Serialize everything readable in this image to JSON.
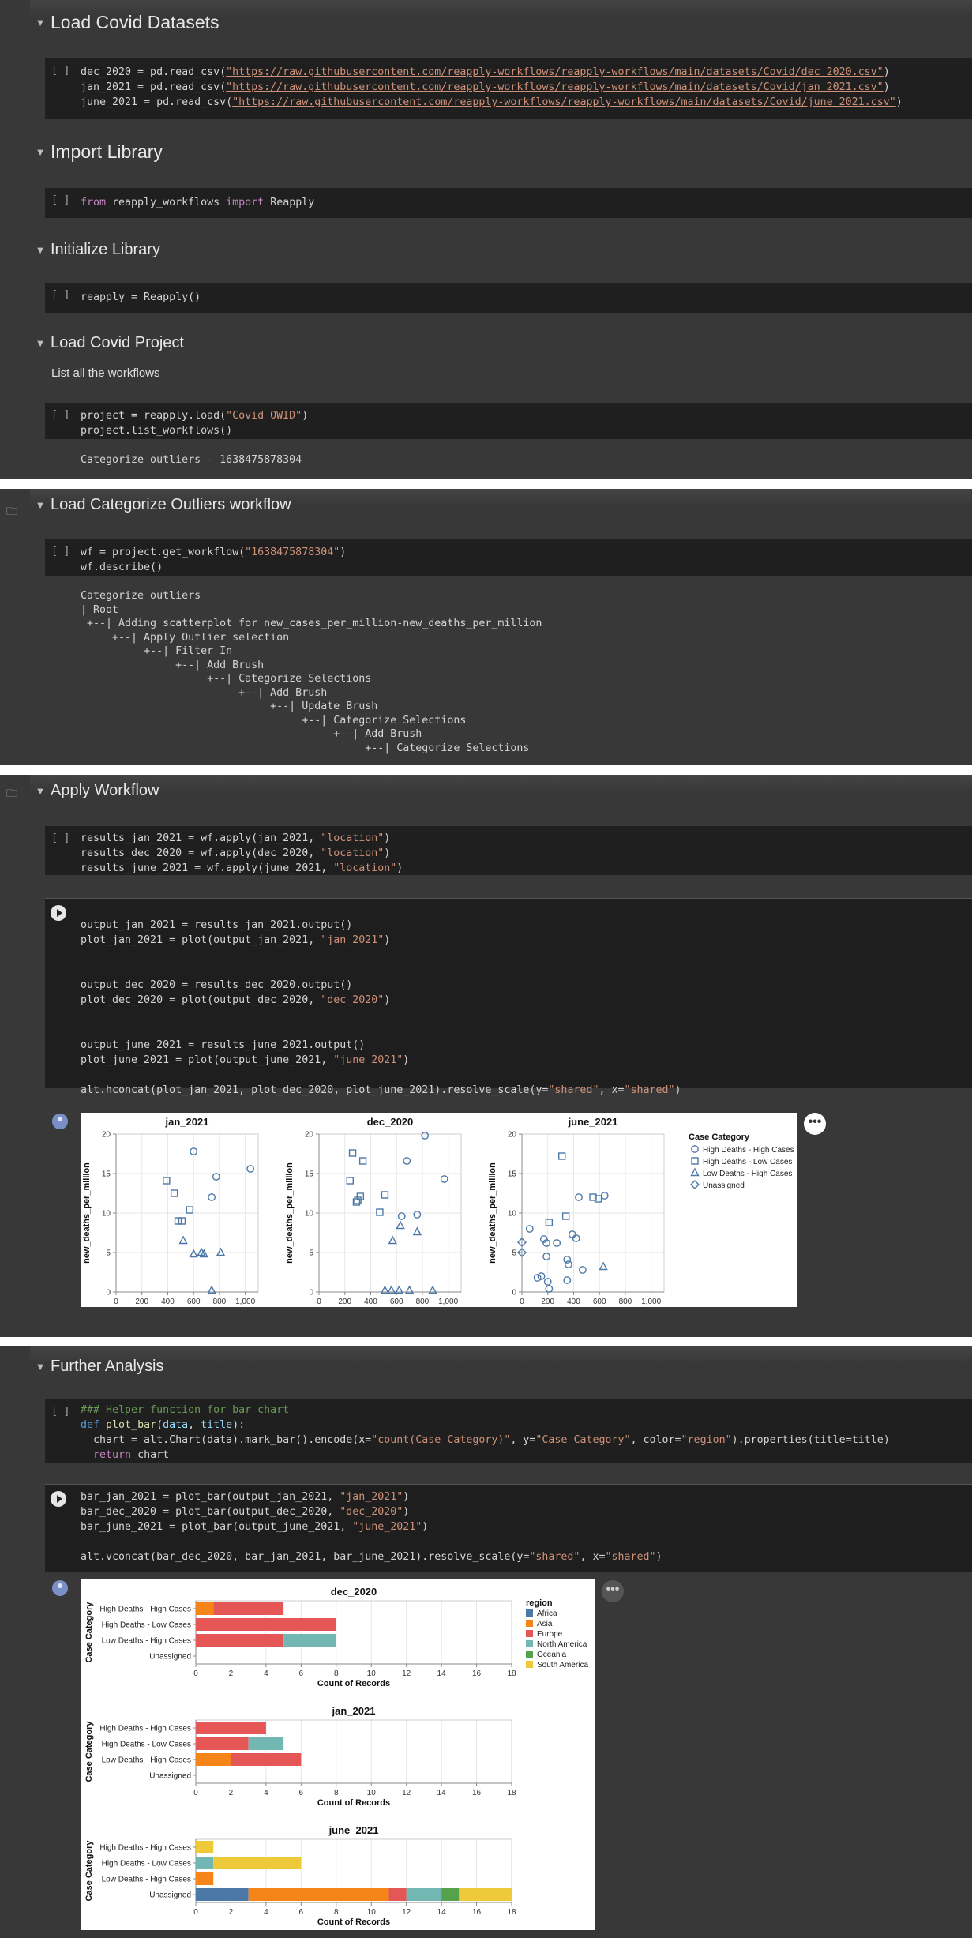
{
  "sections": {
    "load_datasets": {
      "title": "Load Covid Datasets"
    },
    "import_library": {
      "title": "Import Library"
    },
    "initialize_library": {
      "title": "Initialize Library"
    },
    "load_project": {
      "title": "Load Covid Project",
      "description": "List all the workflows"
    },
    "load_workflow": {
      "title": "Load Categorize Outliers workflow"
    },
    "apply_workflow": {
      "title": "Apply Workflow"
    },
    "further_analysis": {
      "title": "Further Analysis"
    }
  },
  "cells": {
    "datasets": {
      "bracket": "[ ]",
      "lines": [
        "dec_2020 = pd.read_csv(\"https://raw.githubusercontent.com/reapply-workflows/reapply-workflows/main/datasets/Covid/dec_2020.csv\")",
        "jan_2021 = pd.read_csv(\"https://raw.githubusercontent.com/reapply-workflows/reapply-workflows/main/datasets/Covid/jan_2021.csv\")",
        "june_2021 = pd.read_csv(\"https://raw.githubusercontent.com/reapply-workflows/reapply-workflows/main/datasets/Covid/june_2021.csv\")"
      ]
    },
    "import": {
      "bracket": "[ ]",
      "line": "from reapply_workflows import Reapply"
    },
    "init": {
      "bracket": "[ ]",
      "line": "reapply = Reapply()"
    },
    "project": {
      "bracket": "[ ]",
      "lines": [
        "project = reapply.load(\"Covid OWID\")",
        "project.list_workflows()"
      ],
      "output": "Categorize outliers - 1638475878304"
    },
    "workflow": {
      "bracket": "[ ]",
      "lines": [
        "wf = project.get_workflow(\"1638475878304\")",
        "wf.describe()"
      ],
      "output": [
        "Categorize outliers",
        "| Root",
        " +--| Adding scatterplot for new_cases_per_million-new_deaths_per_million",
        "     +--| Apply Outlier selection",
        "          +--| Filter In",
        "               +--| Add Brush",
        "                    +--| Categorize Selections",
        "                         +--| Add Brush",
        "                              +--| Update Brush",
        "                                   +--| Categorize Selections",
        "                                        +--| Add Brush",
        "                                             +--| Categorize Selections"
      ]
    },
    "apply": {
      "bracket": "[ ]",
      "lines": [
        "results_jan_2021 = wf.apply(jan_2021, \"location\")",
        "results_dec_2020 = wf.apply(dec_2020, \"location\")",
        "results_june_2021 = wf.apply(june_2021, \"location\")"
      ]
    },
    "plot": {
      "lines": [
        "output_jan_2021 = results_jan_2021.output()",
        "plot_jan_2021 = plot(output_jan_2021, \"jan_2021\")",
        "output_dec_2020 = results_dec_2020.output()",
        "plot_dec_2020 = plot(output_dec_2020, \"dec_2020\")",
        "output_june_2021 = results_june_2021.output()",
        "plot_june_2021 = plot(output_june_2021, \"june_2021\")",
        "alt.hconcat(plot_jan_2021, plot_dec_2020, plot_june_2021).resolve_scale(y=\"shared\", x=\"shared\")"
      ]
    },
    "helper": {
      "bracket": "[ ]",
      "lines": [
        "### Helper function for bar chart",
        "def plot_bar(data, title):",
        "  chart = alt.Chart(data).mark_bar().encode(x=\"count(Case Category)\", y=\"Case Category\", color=\"region\").properties(title=title)",
        "  return chart"
      ]
    },
    "bars": {
      "lines": [
        "bar_jan_2021 = plot_bar(output_jan_2021, \"jan_2021\")",
        "bar_dec_2020 = plot_bar(output_dec_2020, \"dec_2020\")",
        "bar_june_2021 = plot_bar(output_june_2021, \"june_2021\")",
        "alt.vconcat(bar_dec_2020, bar_jan_2021, bar_june_2021).resolve_scale(y=\"shared\", x=\"shared\")"
      ]
    }
  },
  "more_label": "•••",
  "colors": {
    "accent": "#4c78a8"
  },
  "chart_data": [
    {
      "type": "scatter",
      "title": "jan_2021",
      "xlabel": "new_cases_per_million",
      "ylabel": "new_deaths_per_million",
      "xlim": [
        0,
        1100
      ],
      "ylim": [
        0,
        20
      ],
      "xticks": [
        0,
        200,
        400,
        600,
        800,
        1000
      ],
      "xtick_labels": [
        "0",
        "200",
        "400",
        "600",
        "800",
        "1,000"
      ],
      "yticks": [
        0,
        5,
        10,
        15,
        20
      ],
      "series": [
        {
          "name": "High Deaths - High Cases",
          "points": [
            [
              600,
              17.8
            ],
            [
              775,
              14.6
            ],
            [
              1040,
              15.6
            ],
            [
              740,
              12.0
            ]
          ]
        },
        {
          "name": "High Deaths - Low Cases",
          "points": [
            [
              390,
              14.1
            ],
            [
              450,
              12.5
            ],
            [
              480,
              9.0
            ],
            [
              510,
              9.0
            ],
            [
              570,
              10.4
            ]
          ]
        },
        {
          "name": "Low Deaths - High Cases",
          "points": [
            [
              520,
              6.5
            ],
            [
              600,
              4.8
            ],
            [
              660,
              5.0
            ],
            [
              680,
              4.8
            ],
            [
              810,
              5.0
            ],
            [
              740,
              0.2
            ]
          ]
        },
        {
          "name": "Unassigned",
          "points": []
        }
      ]
    },
    {
      "type": "scatter",
      "title": "dec_2020",
      "xlabel": "new_cases_per_million",
      "ylabel": "new_deaths_per_million",
      "xlim": [
        0,
        1100
      ],
      "ylim": [
        0,
        20
      ],
      "xticks": [
        0,
        200,
        400,
        600,
        800,
        1000
      ],
      "xtick_labels": [
        "0",
        "200",
        "400",
        "600",
        "800",
        "1,000"
      ],
      "yticks": [
        0,
        5,
        10,
        15,
        20
      ],
      "series": [
        {
          "name": "High Deaths - High Cases",
          "points": [
            [
              820,
              19.8
            ],
            [
              680,
              16.6
            ],
            [
              970,
              14.3
            ],
            [
              760,
              9.8
            ],
            [
              640,
              9.6
            ]
          ]
        },
        {
          "name": "High Deaths - Low Cases",
          "points": [
            [
              260,
              17.6
            ],
            [
              340,
              16.6
            ],
            [
              240,
              14.1
            ],
            [
              300,
              11.6
            ],
            [
              320,
              12.1
            ],
            [
              290,
              11.4
            ],
            [
              510,
              12.3
            ],
            [
              470,
              10.1
            ]
          ]
        },
        {
          "name": "Low Deaths - High Cases",
          "points": [
            [
              570,
              6.5
            ],
            [
              630,
              8.4
            ],
            [
              760,
              7.6
            ],
            [
              510,
              0.2
            ],
            [
              560,
              0.2
            ],
            [
              620,
              0.2
            ],
            [
              700,
              0.2
            ],
            [
              880,
              0.2
            ]
          ]
        },
        {
          "name": "Unassigned",
          "points": []
        }
      ]
    },
    {
      "type": "scatter",
      "title": "june_2021",
      "xlabel": "new_cases_per_million",
      "ylabel": "new_deaths_per_million",
      "xlim": [
        0,
        1100
      ],
      "ylim": [
        0,
        20
      ],
      "xticks": [
        0,
        200,
        400,
        600,
        800,
        1000
      ],
      "xtick_labels": [
        "0",
        "200",
        "400",
        "600",
        "800",
        "1,000"
      ],
      "yticks": [
        0,
        5,
        10,
        15,
        20
      ],
      "series": [
        {
          "name": "High Deaths - High Cases",
          "points": [
            [
              60,
              8.0
            ],
            [
              170,
              6.7
            ],
            [
              190,
              6.2
            ],
            [
              270,
              6.2
            ],
            [
              350,
              4.1
            ],
            [
              360,
              3.5
            ],
            [
              390,
              7.3
            ],
            [
              420,
              6.8
            ],
            [
              440,
              12.0
            ],
            [
              470,
              2.8
            ],
            [
              640,
              12.2
            ],
            [
              350,
              1.5
            ],
            [
              190,
              4.5
            ],
            [
              150,
              2.0
            ],
            [
              120,
              1.8
            ],
            [
              200,
              1.3
            ],
            [
              210,
              0.4
            ]
          ]
        },
        {
          "name": "High Deaths - Low Cases",
          "points": [
            [
              310,
              17.2
            ],
            [
              210,
              8.8
            ],
            [
              340,
              9.6
            ],
            [
              550,
              12.0
            ],
            [
              590,
              11.8
            ]
          ]
        },
        {
          "name": "Low Deaths - High Cases",
          "points": [
            [
              630,
              3.2
            ]
          ]
        },
        {
          "name": "Unassigned",
          "points": [
            [
              0,
              6.3
            ],
            [
              0,
              5.0
            ]
          ]
        }
      ]
    },
    {
      "type": "bar",
      "title": "dec_2020",
      "xlabel": "Count of Records",
      "ylabel": "Case Category",
      "xlim": [
        0,
        18
      ],
      "xticks": [
        0,
        2,
        4,
        6,
        8,
        10,
        12,
        14,
        16,
        18
      ],
      "categories": [
        "High Deaths - High Cases",
        "High Deaths - Low Cases",
        "Low Deaths - High Cases",
        "Unassigned"
      ],
      "series": [
        {
          "name": "Africa",
          "values": [
            0,
            0,
            0,
            0
          ]
        },
        {
          "name": "Asia",
          "values": [
            1,
            0,
            0,
            0
          ]
        },
        {
          "name": "Europe",
          "values": [
            4,
            8,
            5,
            0
          ]
        },
        {
          "name": "North America",
          "values": [
            0,
            0,
            3,
            0
          ]
        },
        {
          "name": "Oceania",
          "values": [
            0,
            0,
            0,
            0
          ]
        },
        {
          "name": "South America",
          "values": [
            0,
            0,
            0,
            0
          ]
        }
      ]
    },
    {
      "type": "bar",
      "title": "jan_2021",
      "xlabel": "Count of Records",
      "ylabel": "Case Category",
      "xlim": [
        0,
        18
      ],
      "xticks": [
        0,
        2,
        4,
        6,
        8,
        10,
        12,
        14,
        16,
        18
      ],
      "categories": [
        "High Deaths - High Cases",
        "High Deaths - Low Cases",
        "Low Deaths - High Cases",
        "Unassigned"
      ],
      "series": [
        {
          "name": "Africa",
          "values": [
            0,
            0,
            0,
            0
          ]
        },
        {
          "name": "Asia",
          "values": [
            0,
            0,
            2,
            0
          ]
        },
        {
          "name": "Europe",
          "values": [
            4,
            3,
            4,
            0
          ]
        },
        {
          "name": "North America",
          "values": [
            0,
            2,
            0,
            0
          ]
        },
        {
          "name": "Oceania",
          "values": [
            0,
            0,
            0,
            0
          ]
        },
        {
          "name": "South America",
          "values": [
            0,
            0,
            0,
            0
          ]
        }
      ]
    },
    {
      "type": "bar",
      "title": "june_2021",
      "xlabel": "Count of Records",
      "ylabel": "Case Category",
      "xlim": [
        0,
        18
      ],
      "xticks": [
        0,
        2,
        4,
        6,
        8,
        10,
        12,
        14,
        16,
        18
      ],
      "categories": [
        "High Deaths - High Cases",
        "High Deaths - Low Cases",
        "Low Deaths - High Cases",
        "Unassigned"
      ],
      "series": [
        {
          "name": "Africa",
          "values": [
            0,
            0,
            0,
            3
          ]
        },
        {
          "name": "Asia",
          "values": [
            0,
            0,
            1,
            8
          ]
        },
        {
          "name": "Europe",
          "values": [
            0,
            0,
            0,
            1
          ]
        },
        {
          "name": "North America",
          "values": [
            0,
            1,
            0,
            2
          ]
        },
        {
          "name": "Oceania",
          "values": [
            0,
            0,
            0,
            1
          ]
        },
        {
          "name": "South America",
          "values": [
            1,
            5,
            0,
            3
          ]
        }
      ]
    }
  ],
  "scatter_legend": {
    "title": "Case Category",
    "items": [
      "High Deaths - High Cases",
      "High Deaths - Low Cases",
      "Low Deaths - High Cases",
      "Unassigned"
    ]
  },
  "bar_legend": {
    "title": "region",
    "items": [
      {
        "name": "Africa",
        "color": "#4c78a8"
      },
      {
        "name": "Asia",
        "color": "#f58518"
      },
      {
        "name": "Europe",
        "color": "#e45756"
      },
      {
        "name": "North America",
        "color": "#72b7b2"
      },
      {
        "name": "Oceania",
        "color": "#54a24b"
      },
      {
        "name": "South America",
        "color": "#eeca3b"
      }
    ]
  }
}
